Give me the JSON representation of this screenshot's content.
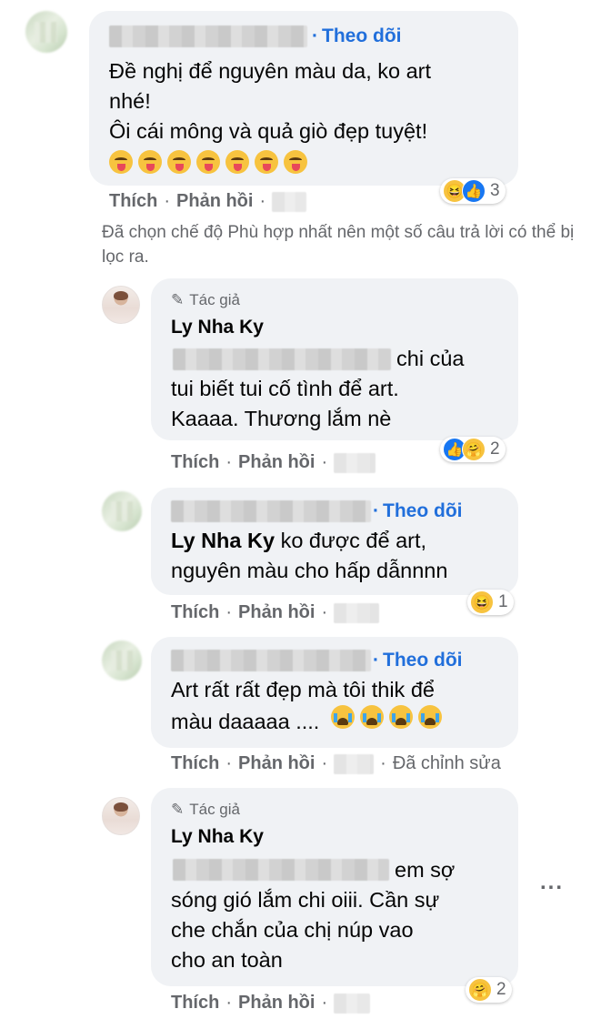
{
  "c1": {
    "follow": "Theo dõi",
    "line1": "Đề nghị để nguyên màu da, ko art",
    "line2": "nhé!",
    "line3": "Ôi cái mông và quả giò đẹp tuyệt!",
    "emoji_icon": "tongue-out-emoji",
    "emoji_count": 7,
    "like": "Thích",
    "reply": "Phản hồi",
    "reaction_count": "3",
    "reaction_icons": [
      "haha-icon",
      "like-icon"
    ]
  },
  "filter_note": "Đã chọn chế độ Phù hợp nhất nên một số câu trả lời có thể bị lọc ra.",
  "c2": {
    "author_badge": "Tác giả",
    "name": "Ly Nha Ky",
    "line1": "chi của",
    "line2": "tui biết tui cố tình để art.",
    "line3": "Kaaaa. Thương lắm nè",
    "like": "Thích",
    "reply": "Phản hồi",
    "reaction_count": "2",
    "reaction_icons": [
      "like-icon",
      "care-icon"
    ]
  },
  "c3": {
    "follow": "Theo dõi",
    "name": "Ly Nha Ky",
    "line1_rest": "ko được để art,",
    "line2": "nguyên màu cho hấp dẫnnnn",
    "like": "Thích",
    "reply": "Phản hồi",
    "reaction_count": "1",
    "reaction_icons": [
      "haha-icon"
    ]
  },
  "c4": {
    "follow": "Theo dõi",
    "line1": "Art rất rất đẹp mà tôi thik để",
    "line2": "màu daaaaa ....",
    "emoji_icon": "crying-emoji",
    "emoji_count": 4,
    "like": "Thích",
    "reply": "Phản hồi",
    "edited": "Đã chỉnh sửa"
  },
  "c5": {
    "author_badge": "Tác giả",
    "name": "Ly Nha Ky",
    "line1": "em sợ",
    "line2": "sóng gió lắm chi oiii. Cần sự",
    "line3": "che chắn của chị núp vao",
    "line4": "cho an toàn",
    "like": "Thích",
    "reply": "Phản hồi",
    "reaction_count": "2",
    "reaction_icons": [
      "care-icon"
    ],
    "more": "..."
  },
  "colors": {
    "link": "#216fdb",
    "bubble": "#f0f2f5",
    "muted": "#65676b"
  }
}
